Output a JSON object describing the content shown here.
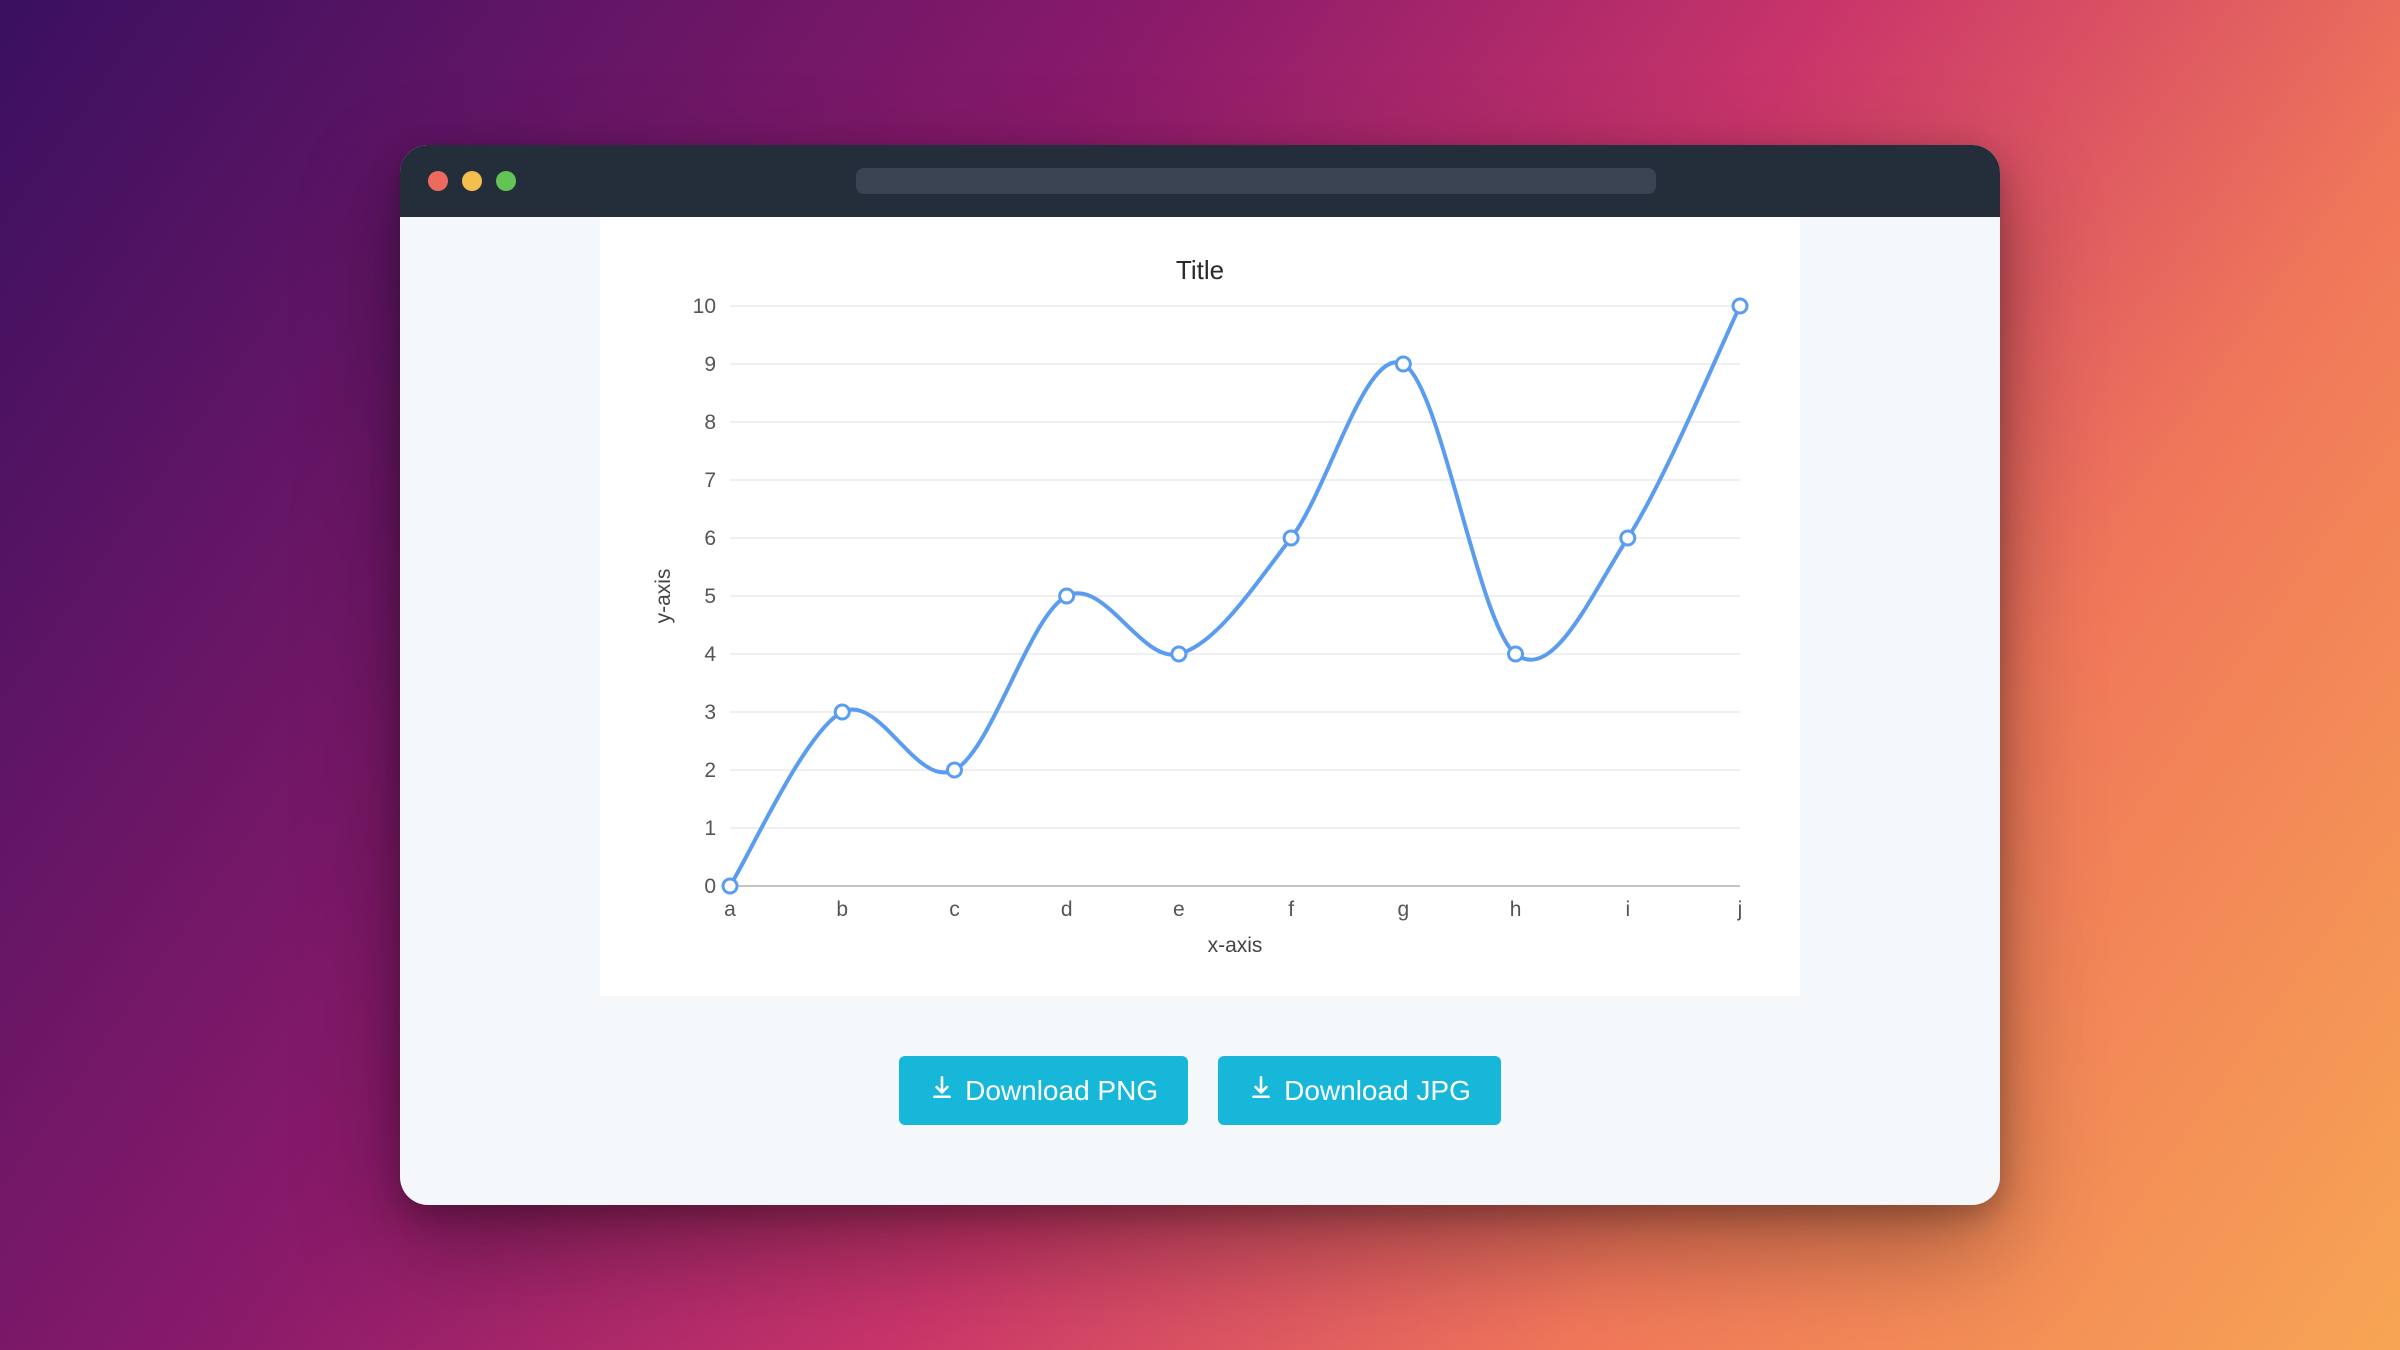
{
  "buttons": {
    "download_png": "Download PNG",
    "download_jpg": "Download JPG"
  },
  "colors": {
    "accent_button": "#16b7d8",
    "series": "#5a9cf0"
  },
  "chart_data": {
    "type": "line",
    "title": "Title",
    "xlabel": "x-axis",
    "ylabel": "y-axis",
    "categories": [
      "a",
      "b",
      "c",
      "d",
      "e",
      "f",
      "g",
      "h",
      "i",
      "j"
    ],
    "values": [
      0,
      3,
      2,
      5,
      4,
      6,
      9,
      4,
      6,
      10
    ],
    "ylim": [
      0,
      10
    ],
    "yticks": [
      0,
      1,
      2,
      3,
      4,
      5,
      6,
      7,
      8,
      9,
      10
    ],
    "grid": true
  }
}
